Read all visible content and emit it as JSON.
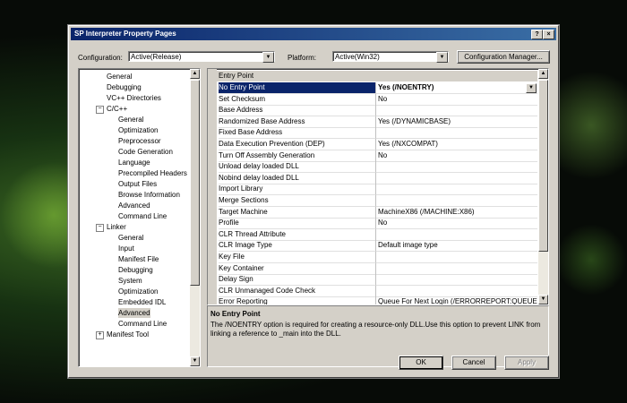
{
  "window": {
    "title": "SP Interpreter Property Pages",
    "help_glyph": "?",
    "close_glyph": "×"
  },
  "config": {
    "label": "Configuration:",
    "value": "Active(Release)",
    "platform_label": "Platform:",
    "platform_value": "Active(Win32)",
    "manager_button": "Configuration Manager..."
  },
  "tree": {
    "items": [
      "General",
      "Debugging",
      "VC++ Directories",
      "C/C++",
      "General",
      "Optimization",
      "Preprocessor",
      "Code Generation",
      "Language",
      "Precompiled Headers",
      "Output Files",
      "Browse Information",
      "Advanced",
      "Command Line",
      "Linker",
      "General",
      "Input",
      "Manifest File",
      "Debugging",
      "System",
      "Optimization",
      "Embedded IDL",
      "Advanced",
      "Command Line",
      "Manifest Tool"
    ]
  },
  "grid": {
    "category": "Entry Point",
    "rows": [
      {
        "k": "No Entry Point",
        "v": "Yes (/NOENTRY)"
      },
      {
        "k": "Set Checksum",
        "v": "No"
      },
      {
        "k": "Base Address",
        "v": ""
      },
      {
        "k": "Randomized Base Address",
        "v": "Yes (/DYNAMICBASE)"
      },
      {
        "k": "Fixed Base Address",
        "v": ""
      },
      {
        "k": "Data Execution Prevention (DEP)",
        "v": "Yes (/NXCOMPAT)"
      },
      {
        "k": "Turn Off Assembly Generation",
        "v": "No"
      },
      {
        "k": "Unload delay loaded DLL",
        "v": ""
      },
      {
        "k": "Nobind delay loaded DLL",
        "v": ""
      },
      {
        "k": "Import Library",
        "v": ""
      },
      {
        "k": "Merge Sections",
        "v": ""
      },
      {
        "k": "Target Machine",
        "v": "MachineX86 (/MACHINE:X86)"
      },
      {
        "k": "Profile",
        "v": "No"
      },
      {
        "k": "CLR Thread Attribute",
        "v": ""
      },
      {
        "k": "CLR Image Type",
        "v": "Default image type"
      },
      {
        "k": "Key File",
        "v": ""
      },
      {
        "k": "Key Container",
        "v": ""
      },
      {
        "k": "Delay Sign",
        "v": ""
      },
      {
        "k": "CLR Unmanaged Code Check",
        "v": ""
      },
      {
        "k": "Error Reporting",
        "v": "Queue For Next Login (/ERRORREPORT:QUEUE)"
      }
    ]
  },
  "description": {
    "title": "No Entry Point",
    "body": "The /NOENTRY option is required for creating a resource-only DLL.Use this option to prevent LINK from linking a reference to _main into the DLL."
  },
  "buttons": {
    "ok": "OK",
    "cancel": "Cancel",
    "apply": "Apply"
  },
  "expanders": {
    "minus": "−",
    "plus": "+"
  }
}
